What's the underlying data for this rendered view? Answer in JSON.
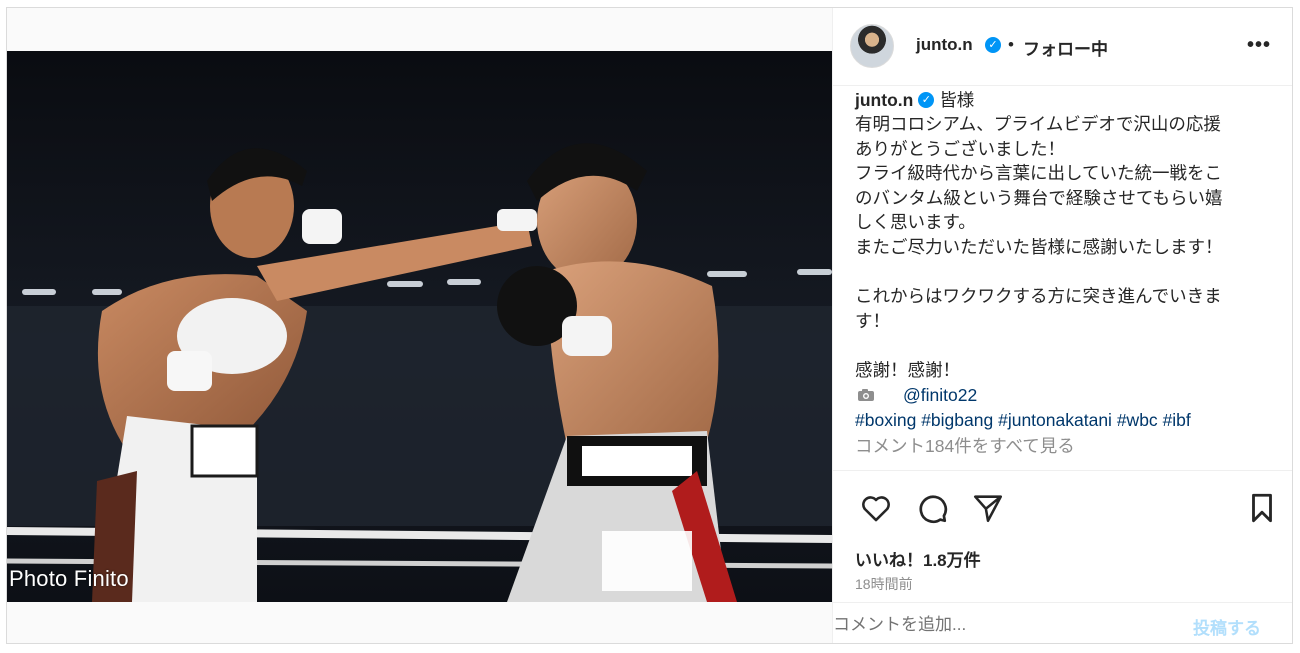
{
  "post": {
    "header": {
      "username": "junto.n",
      "separator": "•",
      "follow_status": "フォロー中",
      "more_label": "•••"
    },
    "media": {
      "photo_credit": "Photo Finito"
    },
    "caption": {
      "username": "junto.n",
      "first_line": "皆様",
      "lines": [
        "有明コロシアム、プライムビデオで沢山の応援",
        "ありがとうございました！",
        "フライ級時代から言葉に出していた統一戦をこ",
        "のバンタム級という舞台で経験させてもらい嬉",
        "しく思います。",
        "またご尽力いただいた皆様に感謝いたします！",
        "",
        "これからはワクワクする方に突き進んでいきま",
        "す！",
        "",
        "感謝！感謝！"
      ],
      "credit_mention": "@finito22",
      "hashtags": [
        "#boxing",
        "#bigbang",
        "#juntonakatani",
        "#wbc",
        "#ibf"
      ],
      "view_comments": "コメント184件をすべて見る"
    },
    "actions": {
      "like_icon": "heart-icon",
      "comment_icon": "comment-icon",
      "share_icon": "paper-plane-icon",
      "save_icon": "bookmark-icon"
    },
    "likes": "いいね！1.8万件",
    "timestamp": "18時間前",
    "comment": {
      "placeholder": "コメントを追加...",
      "post_label": "投稿する"
    },
    "colors": {
      "verified": "#0095f6",
      "link": "#00376b",
      "post_disabled": "#b2dffc",
      "muted": "#8e8e8e"
    }
  }
}
